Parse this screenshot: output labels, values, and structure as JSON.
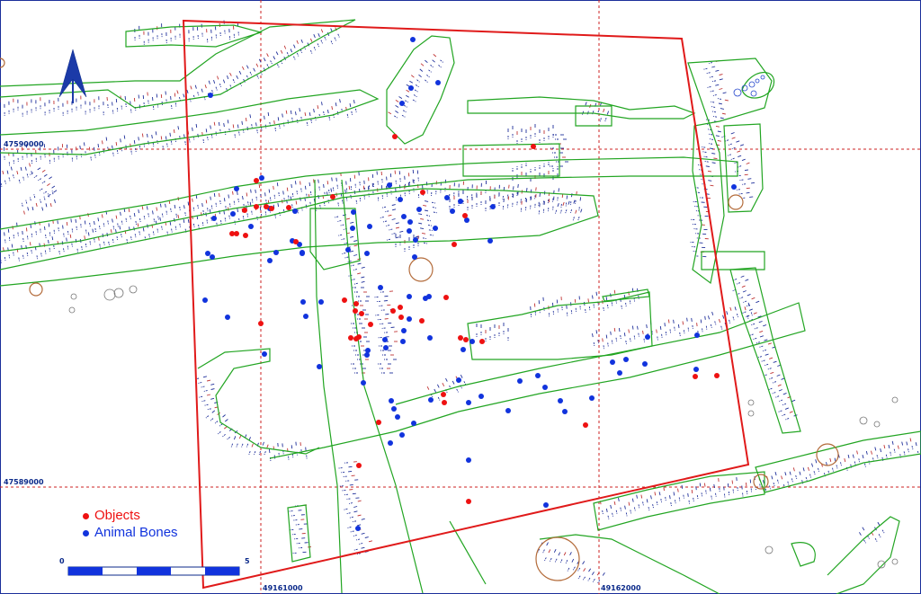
{
  "coordinates": {
    "y_north": "47590000",
    "y_south": "47589000",
    "x_west": "49161000",
    "x_east": "49162000"
  },
  "legend": {
    "objects_label": "Objects",
    "bones_label": "Animal Bones",
    "objects_color": "#ee1111",
    "bones_color": "#1133dd"
  },
  "scale": {
    "start_label": "0",
    "end_label": "5"
  },
  "icons": {
    "north_arrow": "north-arrow-icon"
  },
  "colors": {
    "boundary": "#e01a1a",
    "grid": "#cc2222",
    "feature_outline": "#22a522",
    "hatch_blue": "#1f2f9a",
    "hatch_red": "#c03333"
  }
}
